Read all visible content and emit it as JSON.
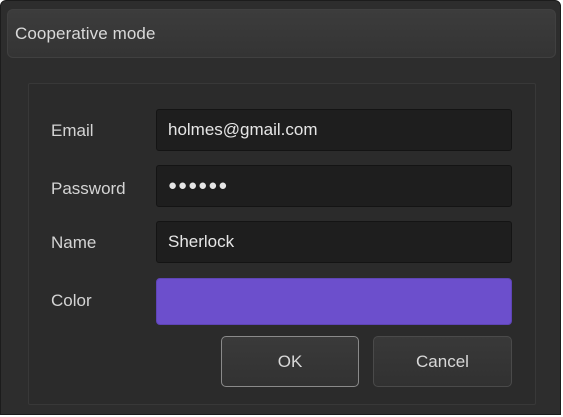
{
  "window": {
    "title": "Cooperative mode"
  },
  "form": {
    "email_label": "Email",
    "email_value": "holmes@gmail.com",
    "password_label": "Password",
    "password_value": "●●●●●●",
    "name_label": "Name",
    "name_value": "Sherlock",
    "color_label": "Color",
    "color_value": "#6c4fcc"
  },
  "buttons": {
    "ok_label": "OK",
    "cancel_label": "Cancel"
  }
}
